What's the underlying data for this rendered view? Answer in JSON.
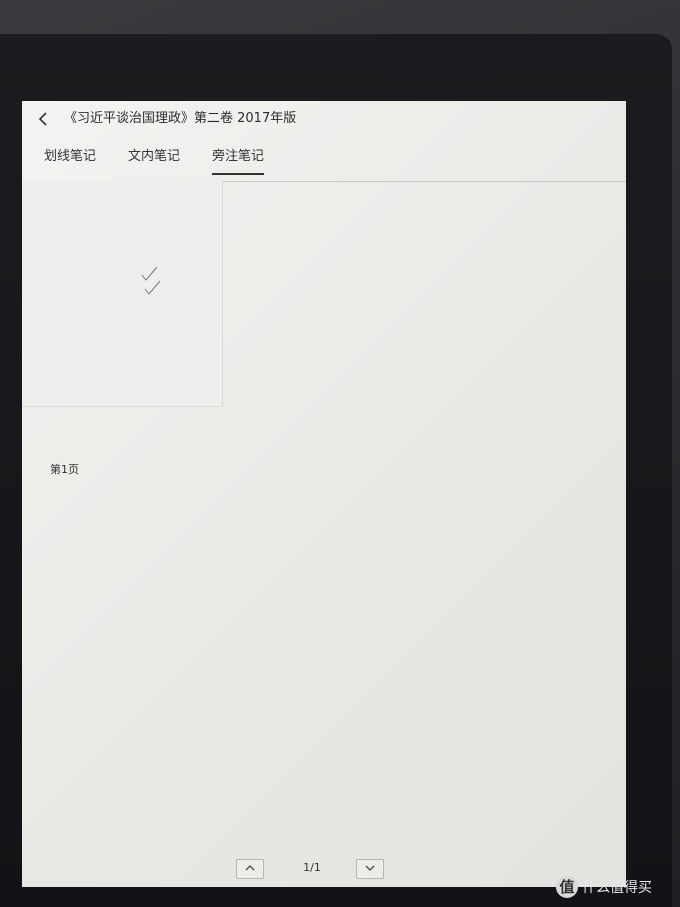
{
  "header": {
    "title": "《习近平谈治国理政》第二卷 2017年版"
  },
  "tabs": [
    {
      "label": "划线笔记",
      "active": false
    },
    {
      "label": "文内笔记",
      "active": false
    },
    {
      "label": "旁注笔记",
      "active": true
    }
  ],
  "note_card": {
    "page_label": "第1页"
  },
  "pager": {
    "indicator": "1/1"
  },
  "watermark": {
    "icon_text": "值",
    "text": "什么值得买"
  }
}
